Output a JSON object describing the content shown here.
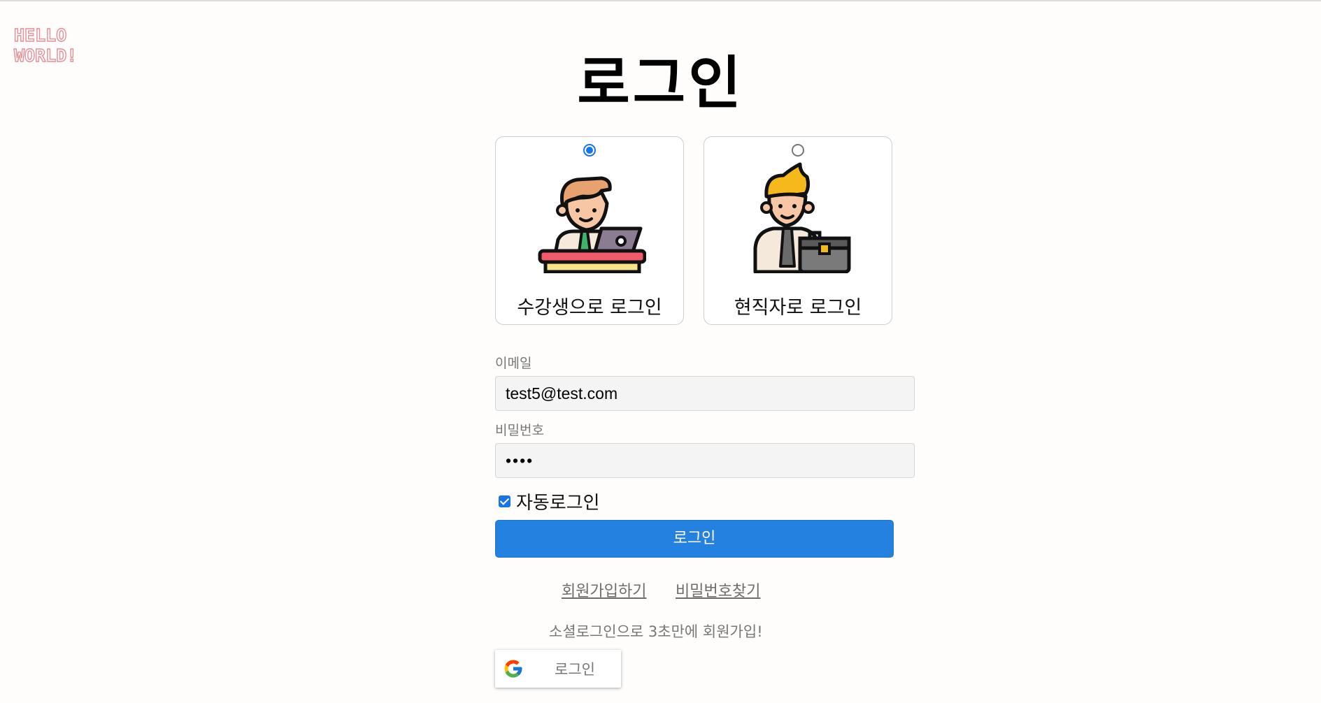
{
  "logo": {
    "line1": "HELLO",
    "line2": "WORLD!"
  },
  "title": "로그인",
  "user_types": [
    {
      "label": "수강생으로 로그인",
      "selected": true,
      "icon": "student-laptop-icon"
    },
    {
      "label": "현직자로 로그인",
      "selected": false,
      "icon": "worker-briefcase-icon"
    }
  ],
  "form": {
    "email_label": "이메일",
    "email_value": "test5@test.com",
    "password_label": "비밀번호",
    "password_value": "••••",
    "auto_login_label": "자동로그인",
    "auto_login_checked": true,
    "submit_label": "로그인"
  },
  "links": {
    "signup": "회원가입하기",
    "find_password": "비밀번호찾기"
  },
  "social": {
    "promo_text": "소셜로그인으로 3초만에 회원가입!",
    "google_label": "로그인",
    "google_icon": "google-icon"
  },
  "colors": {
    "accent": "#2481e0",
    "logo": "#e88d95"
  }
}
